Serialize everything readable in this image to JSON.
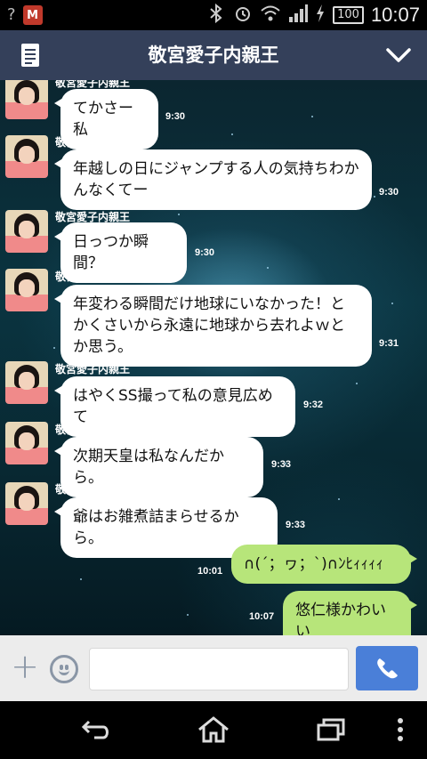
{
  "status_bar": {
    "left_indicator": "?",
    "mcafee_label": "M",
    "battery": "100",
    "time": "10:07",
    "icons": [
      "signal-unknown-icon",
      "mcafee-icon",
      "bluetooth-off-icon",
      "alarm-icon",
      "wifi-icon",
      "signal-bars-icon",
      "charging-icon",
      "battery-icon"
    ]
  },
  "header": {
    "title": "敬宮愛子内親王",
    "menu_icon": "note-icon",
    "expand_icon": "chevron-down-icon",
    "bg_color": "#34405a"
  },
  "messages": [
    {
      "sender": "敬宮愛子内親王",
      "text": "てかさー私",
      "time": "9:30"
    },
    {
      "sender": "敬宮愛子内親王",
      "text": "年越しの日にジャンプする人の気持ちわかんなくてー",
      "time": "9:30"
    },
    {
      "sender": "敬宮愛子内親王",
      "text": "日っつか瞬間？",
      "time": "9:30"
    },
    {
      "sender": "敬宮愛子内親王",
      "text": "年変わる瞬間だけ地球にいなかった！とかくさいから永遠に地球から去れよｗとか思う。",
      "time": "9:31"
    },
    {
      "sender": "敬宮愛子内親王",
      "text": "はやくSS撮って私の意見広めて",
      "time": "9:32"
    },
    {
      "sender": "敬宮愛子内親王",
      "text": "次期天皇は私なんだから。",
      "time": "9:33"
    },
    {
      "sender": "敬宮愛子内親王",
      "text": "爺はお雑煮詰まらせるから。",
      "time": "9:33"
    }
  ],
  "my_messages": [
    {
      "text": "∩(´；ヮ；`)∩ﾝﾋｨｨｨｨ",
      "time": "10:01"
    },
    {
      "text": "悠仁様かわいい",
      "time": "10:07"
    }
  ],
  "input_bar": {
    "placeholder": "",
    "plus_icon": "plus-icon",
    "emoji_icon": "emoji-icon",
    "call_icon": "phone-icon",
    "accent": "#4a7fd8"
  },
  "nav_bar": {
    "icons": [
      "back-icon",
      "home-icon",
      "recent-apps-icon",
      "overflow-menu-icon"
    ]
  }
}
